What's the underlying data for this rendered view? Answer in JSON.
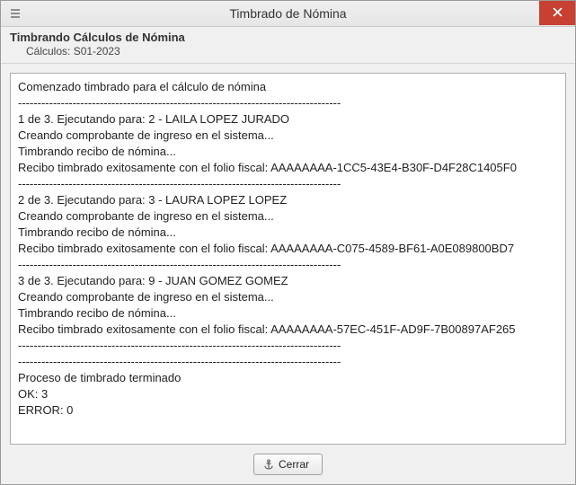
{
  "window": {
    "title": "Timbrado de Nómina",
    "close_icon": "close-icon"
  },
  "header": {
    "title": "Timbrando Cálculos de Nómina",
    "subtitle": "Cálculos: S01-2023"
  },
  "log": {
    "lines": [
      "Comenzado timbrado para el cálculo de nómina",
      "-----------------------------------------------------------------------------------",
      "1 de 3. Ejecutando para: 2 - LAILA LOPEZ JURADO",
      "Creando comprobante de ingreso en el sistema...",
      "Timbrando recibo de nómina...",
      "Recibo timbrado exitosamente con el folio fiscal: AAAAAAAA-1CC5-43E4-B30F-D4F28C1405F0",
      "-----------------------------------------------------------------------------------",
      "2 de 3. Ejecutando para: 3 - LAURA LOPEZ LOPEZ",
      "Creando comprobante de ingreso en el sistema...",
      "Timbrando recibo de nómina...",
      "Recibo timbrado exitosamente con el folio fiscal: AAAAAAAA-C075-4589-BF61-A0E089800BD7",
      "-----------------------------------------------------------------------------------",
      "3 de 3. Ejecutando para: 9 - JUAN GOMEZ GOMEZ",
      "Creando comprobante de ingreso en el sistema...",
      "Timbrando recibo de nómina...",
      "Recibo timbrado exitosamente con el folio fiscal: AAAAAAAA-57EC-451F-AD9F-7B00897AF265",
      "-----------------------------------------------------------------------------------",
      "-----------------------------------------------------------------------------------",
      "Proceso de timbrado terminado",
      "OK: 3",
      "ERROR: 0"
    ]
  },
  "footer": {
    "close_label": "Cerrar"
  }
}
